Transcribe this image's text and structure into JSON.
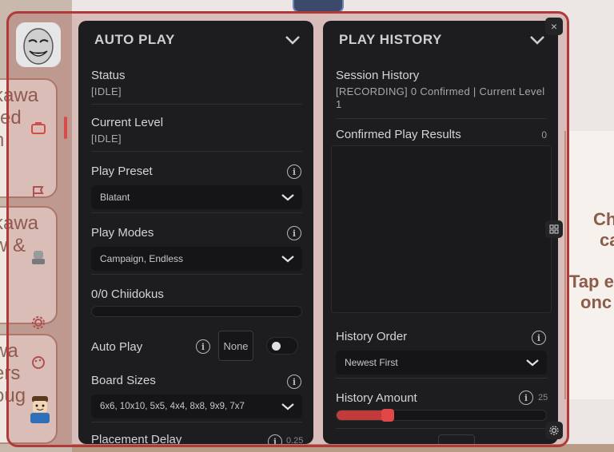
{
  "background": {
    "left_cards": [
      "kawa\nred\nn",
      "kawa\nw &\nr",
      "wa\ners\noug"
    ],
    "right_card_lines": [
      "Ch",
      "ca",
      "",
      "Tap e",
      "onc"
    ]
  },
  "auto_play": {
    "title": "AUTO PLAY",
    "status_label": "Status",
    "status_value": "[IDLE]",
    "current_level_label": "Current Level",
    "current_level_value": "[IDLE]",
    "play_preset_label": "Play Preset",
    "play_preset_value": "Blatant",
    "play_modes_label": "Play Modes",
    "play_modes_value": "Campaign, Endless",
    "chiidokus_label": "0/0 Chiidokus",
    "auto_play_label": "Auto Play",
    "auto_play_keybind": "None",
    "auto_play_enabled": false,
    "board_sizes_label": "Board Sizes",
    "board_sizes_value": "6x6, 10x10, 5x5, 4x4, 8x8, 9x9, 7x7",
    "placement_delay_label": "Placement Delay",
    "placement_delay_value": "0.25"
  },
  "play_history": {
    "title": "PLAY HISTORY",
    "session_history_label": "Session History",
    "session_history_value": "[RECORDING] 0 Confirmed | Current Level 1",
    "confirmed_results_label": "Confirmed Play Results",
    "confirmed_results_count": "0",
    "history_order_label": "History Order",
    "history_order_value": "Newest First",
    "history_amount_label": "History Amount",
    "history_amount_value": "25",
    "history_amount_fraction": 0.22,
    "close_label": "×"
  },
  "colors": {
    "accent": "#c23b3b",
    "panel_bg": "#1d1d1f",
    "frame_border": "#b0393a"
  }
}
